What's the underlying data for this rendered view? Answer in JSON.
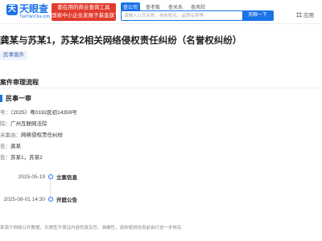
{
  "header": {
    "logo_cn": "天眼查",
    "logo_en": "TianYanCha.com",
    "logo_mark": "天",
    "promo_line1": "都在用的商业查询工具",
    "promo_line2": "国家中小企业发展子基金旗下机构",
    "search_tabs": [
      {
        "label": "查公司"
      },
      {
        "label": "查老板"
      },
      {
        "label": "查关系"
      },
      {
        "label": "查风险"
      }
    ],
    "search_placeholder": "请输入公司名称、老板姓名、品牌名称等",
    "search_button": "天眼一下",
    "apps_label": "应用"
  },
  "case": {
    "title": "龚某与苏某1，苏某2相关网络侵权责任纠纷（名誉权纠纷）",
    "tag": "民事案件"
  },
  "process": {
    "section_title": "案件审理流程",
    "stage_title": "民事一审",
    "fields": [
      {
        "key": "号：",
        "value": "（2025）粤0192民初14359号"
      },
      {
        "key": "院：",
        "value": "广州互联网法院"
      },
      {
        "key": "关案由：",
        "value": "网络侵权责任纠纷"
      },
      {
        "key": "告：",
        "value": "龚某"
      },
      {
        "key": "告：",
        "value": "苏某1，苏某2"
      }
    ],
    "timeline": [
      {
        "date": "2025-05-19",
        "event": "立案信息"
      },
      {
        "date": "2025-08-01 14:30",
        "event": "开庭公告"
      }
    ]
  },
  "footer": {
    "disclaimer": "来源于网络公开数据，天眼查不保证内容的真实性、准确性，请你使用信息前自行进一步核实"
  },
  "colors": {
    "brand_blue": "#1a73e8",
    "promo_red": "#e23b2e"
  },
  "icons": {
    "apps": "grid-icon"
  }
}
